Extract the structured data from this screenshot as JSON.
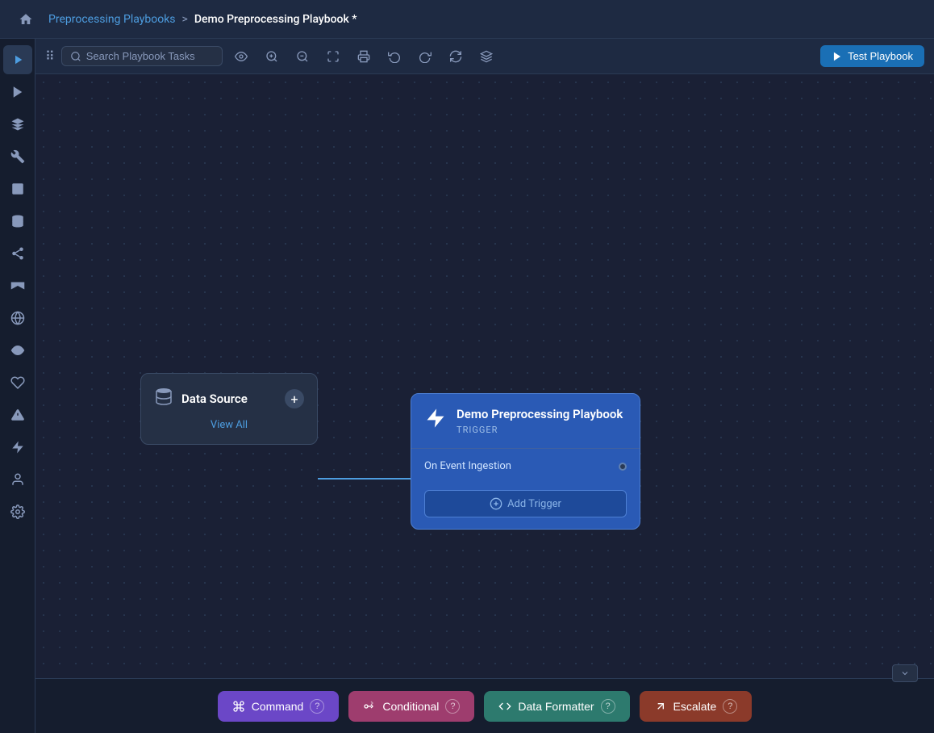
{
  "header": {
    "breadcrumb_link": "Preprocessing Playbooks",
    "separator": ">",
    "current_page": "Demo Preprocessing Playbook *",
    "home_icon": "🏠"
  },
  "toolbar": {
    "search_placeholder": "Search Playbook Tasks",
    "test_playbook_label": "Test Playbook",
    "buttons": [
      {
        "icon": "👁",
        "name": "visibility"
      },
      {
        "icon": "🔍+",
        "name": "zoom-in"
      },
      {
        "icon": "🔍-",
        "name": "zoom-out"
      },
      {
        "icon": "⊞",
        "name": "fit-to-screen"
      },
      {
        "icon": "🖨",
        "name": "print"
      },
      {
        "icon": "↺",
        "name": "reset"
      },
      {
        "icon": "↻",
        "name": "redo"
      },
      {
        "icon": "↺",
        "name": "refresh"
      },
      {
        "icon": "≡",
        "name": "menu"
      }
    ]
  },
  "sidebar": {
    "items": [
      {
        "icon": "▶",
        "name": "playbooks",
        "active": true
      },
      {
        "icon": "▶",
        "name": "run"
      },
      {
        "icon": "⬡",
        "name": "integrations"
      },
      {
        "icon": "⚙",
        "name": "settings-tools"
      },
      {
        "icon": "☐",
        "name": "cases"
      },
      {
        "icon": "⬡",
        "name": "data"
      },
      {
        "icon": "⟳",
        "name": "network"
      },
      {
        "icon": "📡",
        "name": "broadcast"
      },
      {
        "icon": "🌐",
        "name": "globe"
      },
      {
        "icon": "👁",
        "name": "observe"
      },
      {
        "icon": "🤝",
        "name": "handshake"
      },
      {
        "icon": "⚠",
        "name": "alerts"
      },
      {
        "icon": "⚡",
        "name": "lightning"
      },
      {
        "icon": "👤",
        "name": "user"
      },
      {
        "icon": "⚙",
        "name": "gear"
      }
    ]
  },
  "datasource_node": {
    "icon": "🗄",
    "title": "Data Source",
    "add_label": "+",
    "view_all_label": "View All"
  },
  "trigger_node": {
    "icon": "⚡",
    "title": "Demo Preprocessing Playbook",
    "type_label": "TRIGGER",
    "event_label": "On Event Ingestion",
    "add_trigger_label": "Add Trigger",
    "add_trigger_icon": "⊕"
  },
  "bottom_toolbar": {
    "collapse_icon": "∨",
    "buttons": [
      {
        "label": "Command",
        "icon": "⌘",
        "help": "?",
        "class": "btn-command"
      },
      {
        "label": "Conditional",
        "icon": "▷|",
        "help": "?",
        "class": "btn-conditional"
      },
      {
        "label": "Data Formatter",
        "icon": "</>",
        "help": "?",
        "class": "btn-dataformatter"
      },
      {
        "label": "Escalate",
        "icon": "↗",
        "help": "?",
        "class": "btn-escalate"
      }
    ]
  }
}
